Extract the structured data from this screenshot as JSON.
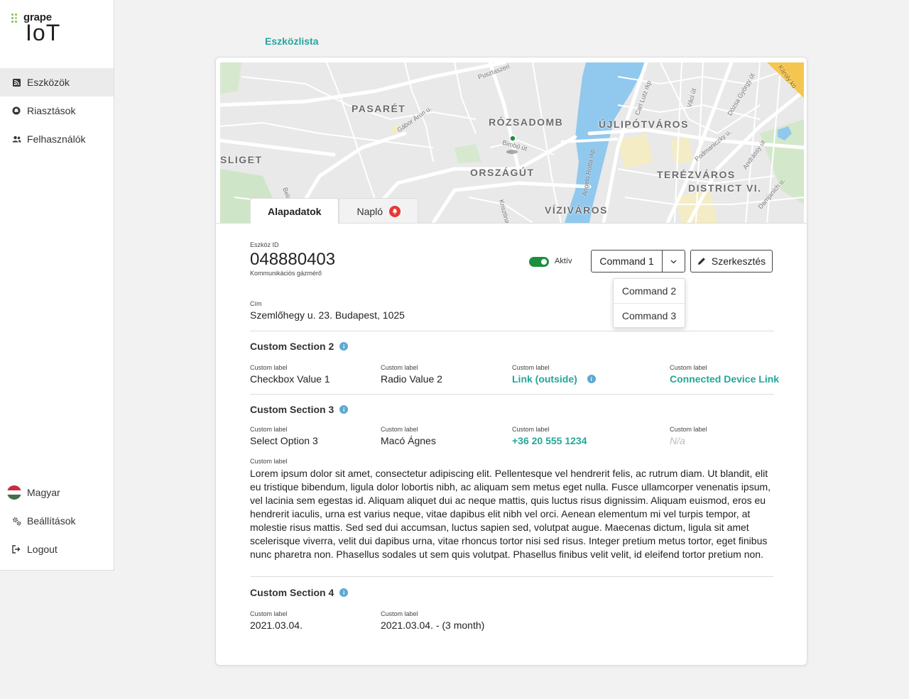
{
  "sidebar": {
    "logo": {
      "brand": "grape",
      "product": "IoT"
    },
    "items": [
      {
        "label": "Eszközök",
        "icon": "rss-icon",
        "active": true
      },
      {
        "label": "Riasztások",
        "icon": "alarm-icon",
        "active": false
      },
      {
        "label": "Felhasználók",
        "icon": "users-icon",
        "active": false
      }
    ],
    "bottom": [
      {
        "label": "Magyar",
        "icon": "hungary-flag-icon"
      },
      {
        "label": "Beállítások",
        "icon": "gears-icon"
      },
      {
        "label": "Logout",
        "icon": "logout-icon"
      }
    ]
  },
  "breadcrumb": "Eszközlista",
  "map": {
    "labels": [
      "PASARÉT",
      "RÓZSADOMB",
      "ÚJLIPÓTVÁROS",
      "SLIGET",
      "ORSZÁGÚT",
      "TERÉZVÁROS",
      "DISTRICT VI.",
      "VÍZIVÁROS"
    ],
    "streets": [
      "Gábor Áron u.",
      "Bimbó út",
      "Carl Lutz rkp",
      "Váci út",
      "Dózsa György út",
      "Podmaniczky u.",
      "Andrássy út",
      "Damjanich u.",
      "Angelo Rotta rkp",
      "Krisztina",
      "Pusztaszeri",
      "Bela",
      "Károly kö"
    ]
  },
  "tabs": [
    {
      "label": "Alapadatok",
      "active": true
    },
    {
      "label": "Napló",
      "active": false,
      "alert": true
    }
  ],
  "device": {
    "id_label": "Eszköz ID",
    "id": "048880403",
    "type": "Kommunikációs gázmérő",
    "status_label": "Aktív",
    "status_on": true,
    "address_label": "Cím",
    "address": "Szemlőhegy u. 23. Budapest, 1025"
  },
  "commands": {
    "current": "Command 1",
    "options": [
      "Command 2",
      "Command 3"
    ]
  },
  "edit_label": "Szerkesztés",
  "sections": {
    "s2": {
      "title": "Custom Section 2",
      "fields": [
        {
          "label": "Custom label",
          "value": "Checkbox Value 1"
        },
        {
          "label": "Custom label",
          "value": "Radio Value 2"
        },
        {
          "label": "Custom label",
          "value": "Link (outside)"
        },
        {
          "label": "Custom label",
          "value": "Connected Device Link"
        }
      ]
    },
    "s3": {
      "title": "Custom Section 3",
      "fields": [
        {
          "label": "Custom label",
          "value": "Select Option 3"
        },
        {
          "label": "Custom label",
          "value": "Macó Ágnes"
        },
        {
          "label": "Custom label",
          "value": "+36 20 555 1234"
        },
        {
          "label": "Custom label",
          "value": "N/a"
        }
      ],
      "text_label": "Custom label",
      "text": "Lorem ipsum dolor sit amet, consectetur adipiscing elit. Pellentesque vel hendrerit felis, ac rutrum diam. Ut blandit, elit eu tristique bibendum, ligula dolor lobortis nibh, ac aliquam sem metus eget nulla. Fusce ullamcorper venenatis ipsum, vel lacinia sem egestas id. Aliquam aliquet dui ac neque mattis, quis luctus risus dignissim. Aliquam euismod, eros eu hendrerit iaculis, urna est varius neque, vitae dapibus elit nibh vel orci. Aenean elementum mi vel turpis tempor, at molestie risus mattis. Sed sed dui accumsan, luctus sapien sed, volutpat augue. Maecenas dictum, ligula sit amet scelerisque viverra, velit dui dapibus urna, vitae rhoncus tortor nisi sed risus. Integer pretium metus tortor, eget finibus nunc pharetra non. Phasellus sodales ut sem quis volutpat. Phasellus finibus velit velit, id eleifend tortor pretium non."
    },
    "s4": {
      "title": "Custom Section 4",
      "fields": [
        {
          "label": "Custom label",
          "value": "2021.03.04."
        },
        {
          "label": "Custom label",
          "value": "2021.03.04. - (3 month)"
        }
      ]
    }
  },
  "colors": {
    "accent": "#26a69a",
    "toggle": "#1e8e3e",
    "alert": "#e53935",
    "info": "#5fa8d3"
  }
}
